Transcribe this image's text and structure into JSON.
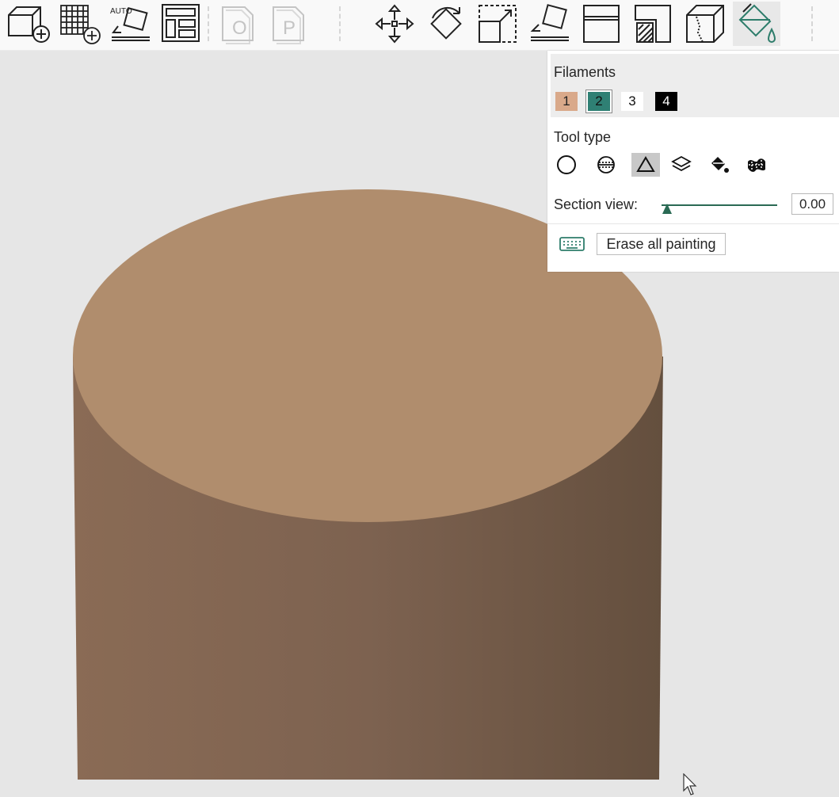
{
  "toolbar": {
    "buttons": [
      {
        "name": "add-object",
        "icon": "cube-plus-icon"
      },
      {
        "name": "add-plate",
        "icon": "grid-plus-icon"
      },
      {
        "name": "auto-orient",
        "icon": "auto-orient-icon",
        "label": "AUTO"
      },
      {
        "name": "arrange",
        "icon": "layout-icon"
      },
      {
        "name": "object-placeholder",
        "icon": "sheet-o-icon",
        "label": "O",
        "disabled": true
      },
      {
        "name": "plate-placeholder",
        "icon": "sheet-p-icon",
        "label": "P",
        "disabled": true
      },
      {
        "name": "move",
        "icon": "move-arrows-icon"
      },
      {
        "name": "rotate",
        "icon": "rotate-icon"
      },
      {
        "name": "scale",
        "icon": "scale-icon"
      },
      {
        "name": "lay-on-face",
        "icon": "place-on-face-icon"
      },
      {
        "name": "cut",
        "icon": "cut-icon"
      },
      {
        "name": "support-paint",
        "icon": "support-paint-icon"
      },
      {
        "name": "seam-paint",
        "icon": "seam-paint-icon"
      },
      {
        "name": "color-paint",
        "icon": "paint-bucket-icon",
        "active": true
      }
    ],
    "accent": "#2e7d6b"
  },
  "panel": {
    "filaments_title": "Filaments",
    "filaments": [
      {
        "label": "1",
        "bg": "#d9a98a",
        "fg": "#222222"
      },
      {
        "label": "2",
        "bg": "#2f8074",
        "fg": "#111111",
        "selected": true
      },
      {
        "label": "3",
        "bg": "#ffffff",
        "fg": "#111111"
      },
      {
        "label": "4",
        "bg": "#000000",
        "fg": "#ffffff"
      }
    ],
    "tooltype_title": "Tool type",
    "tools": [
      {
        "name": "circle",
        "icon": "circle-icon"
      },
      {
        "name": "sphere",
        "icon": "sphere-icon"
      },
      {
        "name": "triangle",
        "icon": "triangle-icon",
        "selected": true
      },
      {
        "name": "height-range",
        "icon": "layers-icon"
      },
      {
        "name": "fill",
        "icon": "fill-bucket-icon"
      },
      {
        "name": "gap-fill",
        "icon": "gap-fill-icon"
      }
    ],
    "section_label": "Section view:",
    "section_value": "0.00",
    "section_level": 0.0,
    "erase_label": "Erase all painting"
  }
}
